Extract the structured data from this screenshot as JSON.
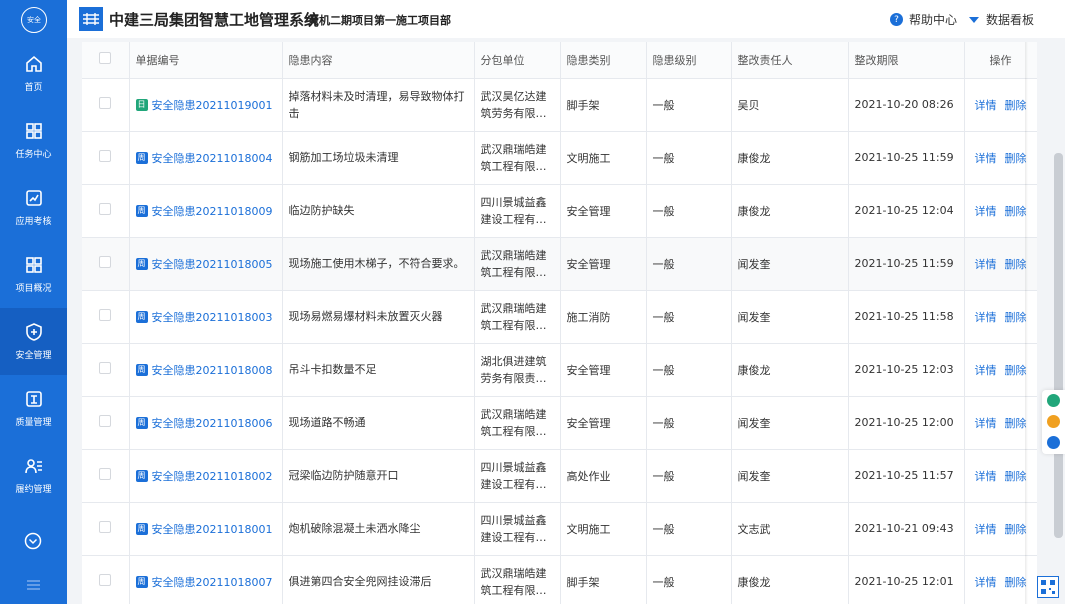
{
  "sidebar": {
    "avatar_text": "安全",
    "items": [
      {
        "label": "首页",
        "icon": "home-icon"
      },
      {
        "label": "任务中心",
        "icon": "grid-icon"
      },
      {
        "label": "应用考核",
        "icon": "chart-card-icon"
      },
      {
        "label": "项目概况",
        "icon": "grid-icon"
      },
      {
        "label": "安全管理",
        "icon": "shield-plus-icon",
        "active": true
      },
      {
        "label": "质量管理",
        "icon": "quality-badge-icon"
      },
      {
        "label": "履约管理",
        "icon": "user-list-icon"
      }
    ]
  },
  "header": {
    "system_title": "中建三局集团智慧工地管理系统",
    "project_title": "黄机二期项目第一施工项目部",
    "help": "帮助中心",
    "dashboard": "数据看板"
  },
  "table": {
    "columns": [
      "单据编号",
      "隐患内容",
      "分包单位",
      "隐患类别",
      "隐患级别",
      "整改责任人",
      "整改期限",
      "操作"
    ],
    "action_detail": "详情",
    "action_delete": "删除",
    "rows": [
      {
        "badge": "日",
        "badge_color": "#21a67a",
        "code": "安全隐患20211019001",
        "content": "掉落材料未及时清理，易导致物体打击",
        "unit": "武汉昊亿达建筑劳务有限公...",
        "category": "脚手架",
        "level": "一般",
        "owner": "吴贝",
        "deadline": "2021-10-20 08:26"
      },
      {
        "badge": "周",
        "badge_color": "#1b6fd8",
        "code": "安全隐患20211018004",
        "content": "钢筋加工场垃圾未清理",
        "unit": "武汉鼎瑞皓建筑工程有限公...",
        "category": "文明施工",
        "level": "一般",
        "owner": "康俊龙",
        "deadline": "2021-10-25 11:59"
      },
      {
        "badge": "周",
        "badge_color": "#1b6fd8",
        "code": "安全隐患20211018009",
        "content": "临边防护缺失",
        "unit": "四川景城益鑫建设工程有限...",
        "category": "安全管理",
        "level": "一般",
        "owner": "康俊龙",
        "deadline": "2021-10-25 12:04"
      },
      {
        "badge": "周",
        "badge_color": "#1b6fd8",
        "code": "安全隐患20211018005",
        "content": "现场施工使用木梯子，不符合要求。",
        "unit": "武汉鼎瑞皓建筑工程有限公...",
        "category": "安全管理",
        "level": "一般",
        "owner": "闻发奎",
        "deadline": "2021-10-25 11:59"
      },
      {
        "badge": "周",
        "badge_color": "#1b6fd8",
        "code": "安全隐患20211018003",
        "content": "现场易燃易爆材料未放置灭火器",
        "unit": "武汉鼎瑞皓建筑工程有限公...",
        "category": "施工消防",
        "level": "一般",
        "owner": "闻发奎",
        "deadline": "2021-10-25 11:58"
      },
      {
        "badge": "周",
        "badge_color": "#1b6fd8",
        "code": "安全隐患20211018008",
        "content": "吊斗卡扣数量不足",
        "unit": "湖北俱进建筑劳务有限责任...",
        "category": "安全管理",
        "level": "一般",
        "owner": "康俊龙",
        "deadline": "2021-10-25 12:03"
      },
      {
        "badge": "周",
        "badge_color": "#1b6fd8",
        "code": "安全隐患20211018006",
        "content": "现场道路不畅通",
        "unit": "武汉鼎瑞皓建筑工程有限公...",
        "category": "安全管理",
        "level": "一般",
        "owner": "闻发奎",
        "deadline": "2021-10-25 12:00"
      },
      {
        "badge": "周",
        "badge_color": "#1b6fd8",
        "code": "安全隐患20211018002",
        "content": "冠梁临边防护随意开口",
        "unit": "四川景城益鑫建设工程有限...",
        "category": "高处作业",
        "level": "一般",
        "owner": "闻发奎",
        "deadline": "2021-10-25 11:57"
      },
      {
        "badge": "周",
        "badge_color": "#1b6fd8",
        "code": "安全隐患20211018001",
        "content": "炮机破除混凝土未洒水降尘",
        "unit": "四川景城益鑫建设工程有限...",
        "category": "文明施工",
        "level": "一般",
        "owner": "文志武",
        "deadline": "2021-10-21 09:43"
      },
      {
        "badge": "周",
        "badge_color": "#1b6fd8",
        "code": "安全隐患20211018007",
        "content": "俱进第四合安全兜网挂设滞后",
        "unit": "武汉鼎瑞皓建筑工程有限公...",
        "category": "脚手架",
        "level": "一般",
        "owner": "康俊龙",
        "deadline": "2021-10-25 12:01"
      }
    ]
  }
}
